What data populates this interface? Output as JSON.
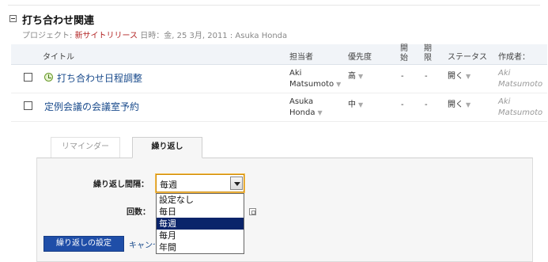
{
  "section": {
    "title": "打ち合わせ関連",
    "meta_prefix": "プロジェクト: ",
    "project": "新サイトリリース",
    "meta_suffix": " 日時：金, 25 3月, 2011 : Asuka Honda"
  },
  "table": {
    "headers": {
      "title": "タイトル",
      "assignee": "担当者",
      "priority": "優先度",
      "start_1": "開",
      "start_2": "始",
      "due_1": "期",
      "due_2": "限",
      "status": "ステータス",
      "creator": "作成者："
    },
    "rows": [
      {
        "title": "打ち合わせ日程調整",
        "assignee_1": "Aki",
        "assignee_2": "Matsumoto",
        "priority": "高",
        "start": "-",
        "due": "-",
        "status": "開く",
        "creator_1": "Aki",
        "creator_2": "Matsumoto"
      },
      {
        "title": "定例会議の会議室予約",
        "assignee_1": "Asuka",
        "assignee_2": "Honda",
        "priority": "中",
        "start": "-",
        "due": "-",
        "status": "開く",
        "creator_1": "Aki",
        "creator_2": "Matsumoto"
      }
    ]
  },
  "tabs": {
    "reminder": "リマインダー",
    "repeat": "繰り返し"
  },
  "form": {
    "interval_label": "繰り返し間隔：",
    "count_label": "回数：",
    "interval_value": "毎週",
    "options": [
      "設定なし",
      "毎日",
      "毎週",
      "毎月",
      "年間"
    ],
    "selected_index": 2
  },
  "buttons": {
    "save": "繰り返しの設定",
    "cancel": "キャンセル"
  },
  "icons": {
    "section_toggle": "collapse-icon",
    "task_icon": "clock-icon",
    "dropdown_arrow": "chevron-down-icon"
  },
  "colors": {
    "project": "#b22222",
    "link": "#1a4b8c",
    "primary_button": "#1f4ea8",
    "selected_option": "#0a246a"
  }
}
